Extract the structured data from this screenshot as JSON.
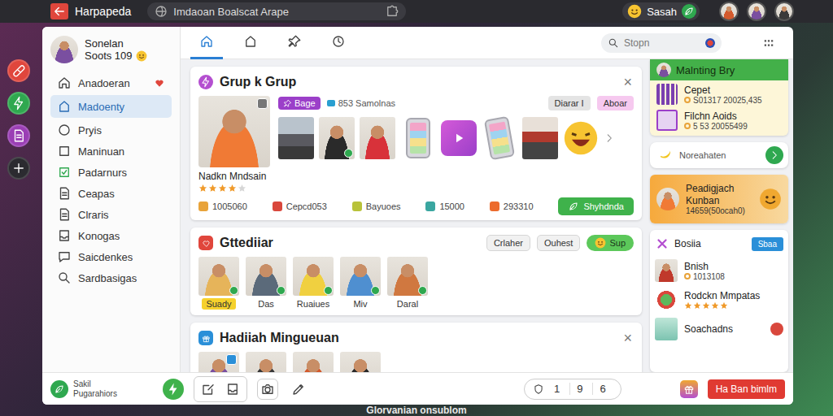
{
  "topbar": {
    "app_name": "Harpapeda",
    "address": "Imdaoan Boalscat Arape",
    "user": "Sasah"
  },
  "rail": [
    {
      "color": "#e0463c"
    },
    {
      "color": "#2fa84f"
    },
    {
      "color": "#9b3fb5"
    },
    {
      "color": "#2b2b30"
    }
  ],
  "profile": {
    "name": "Sonelan",
    "status": "Soots 109"
  },
  "sidebar": {
    "items": [
      {
        "label": "Anadoeran",
        "selected": false
      },
      {
        "label": "Madoenty",
        "selected": true
      },
      {
        "label": "Pryis",
        "selected": false
      },
      {
        "label": "Maninuan",
        "selected": false
      },
      {
        "label": "Padarnurs",
        "selected": false
      },
      {
        "label": "Ceapas",
        "selected": false
      },
      {
        "label": "Clraris",
        "selected": false
      },
      {
        "label": "Konogas",
        "selected": false
      },
      {
        "label": "Saicdenkes",
        "selected": false
      },
      {
        "label": "Sardbasigas",
        "selected": false
      }
    ]
  },
  "toolbar": {
    "tabs": [
      {
        "selected": true
      },
      {
        "selected": false
      },
      {
        "selected": false
      },
      {
        "selected": false
      }
    ],
    "search_placeholder": "Stopn"
  },
  "groups_card": {
    "title": "Grup k Grup",
    "close": "×",
    "tag": "Bage",
    "members": "853 Samolnas",
    "chips": [
      {
        "label": "Diarar I",
        "color": "#e4e4e4"
      },
      {
        "label": "Aboar",
        "color": "#f6c9ef"
      }
    ],
    "person": "Nadkn Mndsain",
    "stars": 4,
    "stats": [
      "1005060",
      "Cepcd053",
      "Bayuoes",
      "15000",
      "293310"
    ],
    "action": "Shyhdnda"
  },
  "people_card": {
    "title": "Gttediiar",
    "buttons": [
      "Crlaher",
      "Ouhest"
    ],
    "primary": "Sup",
    "people": [
      {
        "name": "Suady",
        "selected": true
      },
      {
        "name": "Das",
        "selected": false
      },
      {
        "name": "Ruaiues",
        "selected": false
      },
      {
        "name": "Miv",
        "selected": false
      },
      {
        "name": "Daral",
        "selected": false
      }
    ]
  },
  "gifts_card": {
    "title": "Hadiiah Mingueuan",
    "close": "×"
  },
  "side": {
    "panel": {
      "title": "Malnting Bry",
      "items": [
        {
          "title": "Cepet",
          "meta": "S01317 20025,435"
        },
        {
          "title": "Filchn Aoids",
          "meta": "5 53 20055499"
        }
      ]
    },
    "notice": "Noreahaten",
    "promo": {
      "title": "Peadigjach Kunban",
      "meta": "14659(50ocah0)"
    },
    "section": {
      "title": "Bosiia",
      "button": "Sbaa",
      "items": [
        {
          "kind": "meta",
          "title": "Bnish",
          "meta": "1013108"
        },
        {
          "kind": "stars",
          "title": "Rodckn Mmpatas",
          "stars": 5
        },
        {
          "kind": "plain",
          "title": "Soachadns"
        }
      ]
    }
  },
  "bottombar": {
    "brand": [
      "Sakil",
      "Pugarahiors"
    ],
    "counters": [
      "1",
      "9",
      "6"
    ],
    "button": "Ha Ban bimlm"
  },
  "footer": "Glorvanian onsublom"
}
